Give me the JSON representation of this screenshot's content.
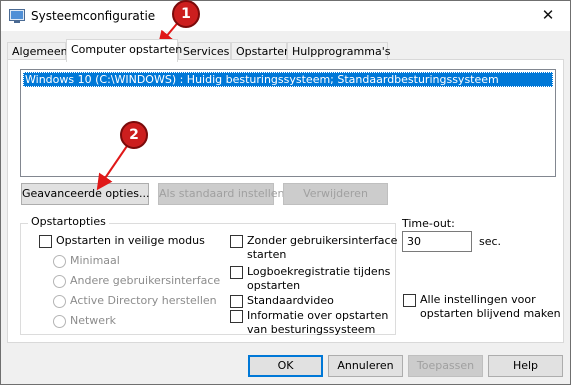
{
  "window": {
    "title": "Systeemconfiguratie",
    "close_glyph": "✕"
  },
  "tabs": [
    {
      "label": "Algemeen",
      "active": false
    },
    {
      "label": "Computer opstarten",
      "active": true
    },
    {
      "label": "Services",
      "active": false
    },
    {
      "label": "Opstarten",
      "active": false
    },
    {
      "label": "Hulpprogramma's",
      "active": false
    }
  ],
  "boot": {
    "entries": [
      "Windows 10 (C:\\WINDOWS) : Huidig besturingssysteem; Standaardbesturingssysteem"
    ],
    "advanced_options_button": "Geavanceerde opties...",
    "set_default_button": "Als standaard instellen",
    "delete_button": "Verwijderen"
  },
  "boot_options": {
    "group_title": "Opstartopties",
    "safe_boot": {
      "label": "Opstarten in veilige modus",
      "checked": false
    },
    "safe_boot_modes": [
      {
        "label": "Minimaal",
        "selected": false
      },
      {
        "label": "Andere gebruikersinterface",
        "selected": false
      },
      {
        "label": "Active Directory herstellen",
        "selected": false
      },
      {
        "label": "Netwerk",
        "selected": false
      }
    ],
    "no_gui_boot": {
      "label_line1": "Zonder gebruikersinterface",
      "label_line2": "starten",
      "checked": false
    },
    "boot_log": {
      "label_line1": "Logboekregistratie tijdens",
      "label_line2": "opstarten",
      "checked": false
    },
    "base_video": {
      "label": "Standaardvideo",
      "checked": false
    },
    "os_boot_info": {
      "label_line1": "Informatie over opstarten",
      "label_line2": "van besturingssysteem",
      "checked": false
    }
  },
  "timeout": {
    "label": "Time-out:",
    "value": "30",
    "unit": "sec."
  },
  "make_permanent": {
    "label_line1": "Alle instellingen voor",
    "label_line2": "opstarten blijvend maken",
    "checked": false
  },
  "footer": {
    "ok": "OK",
    "cancel": "Annuleren",
    "apply": "Toepassen",
    "help": "Help"
  },
  "annotations": [
    {
      "number": "1"
    },
    {
      "number": "2"
    }
  ],
  "colors": {
    "selection": "#0078d7",
    "annotation_red": "#cc1e1e"
  }
}
